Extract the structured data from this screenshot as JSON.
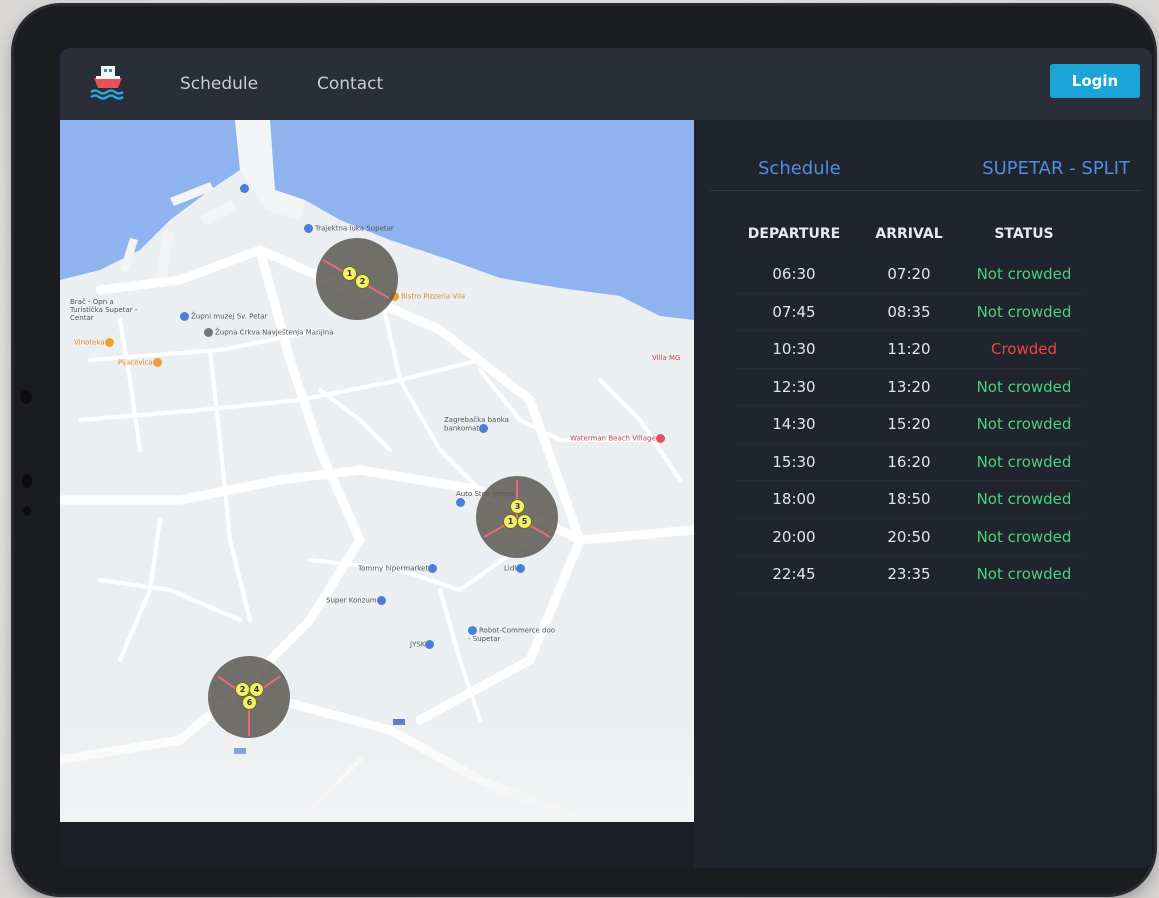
{
  "navbar": {
    "logo": "ship-logo-icon",
    "links": [
      "Schedule",
      "Contact"
    ],
    "login_label": "Login"
  },
  "map": {
    "pois": [
      {
        "label": "Trajektna luka Supetar",
        "kind": "blue"
      },
      {
        "label": "Bistro Pizzeria Vila",
        "kind": "orange"
      },
      {
        "label": "Župni muzej Sv. Petar",
        "kind": "blue"
      },
      {
        "label": "Župna Crkva Navještenja Marijina",
        "kind": "gray"
      },
      {
        "label": "Vinoteka",
        "kind": "orange"
      },
      {
        "label": "Pijacevica",
        "kind": "orange"
      },
      {
        "label": "Brač - Opn a Turistička Supetar - Centar",
        "kind": "blue"
      },
      {
        "label": "Zagrebačka banka bankomat",
        "kind": "blue"
      },
      {
        "label": "Waterman Beach Village",
        "kind": "red"
      },
      {
        "label": "Villa MG",
        "kind": "red"
      },
      {
        "label": "Auto Stop Jelena",
        "kind": "blue"
      },
      {
        "label": "Tommy hipermarket",
        "kind": "blue"
      },
      {
        "label": "Lidl",
        "kind": "blue"
      },
      {
        "label": "Super Konzum",
        "kind": "blue"
      },
      {
        "label": "JYSK",
        "kind": "blue"
      },
      {
        "label": "Robot-Commerce doo - Supetar",
        "kind": "blue"
      }
    ],
    "clusters": [
      {
        "markers": [
          "1",
          "2"
        ]
      },
      {
        "markers": [
          "3",
          "1",
          "5"
        ]
      },
      {
        "markers": [
          "2",
          "4",
          "6"
        ]
      }
    ]
  },
  "panel": {
    "tab_schedule": "Schedule",
    "route": "SUPETAR - SPLIT",
    "headers": [
      "DEPARTURE",
      "ARRIVAL",
      "STATUS"
    ],
    "rows": [
      {
        "departure": "06:30",
        "arrival": "07:20",
        "status": "Not crowded",
        "crowded": false
      },
      {
        "departure": "07:45",
        "arrival": "08:35",
        "status": "Not crowded",
        "crowded": false
      },
      {
        "departure": "10:30",
        "arrival": "11:20",
        "status": "Crowded",
        "crowded": true
      },
      {
        "departure": "12:30",
        "arrival": "13:20",
        "status": "Not crowded",
        "crowded": false
      },
      {
        "departure": "14:30",
        "arrival": "15:20",
        "status": "Not crowded",
        "crowded": false
      },
      {
        "departure": "15:30",
        "arrival": "16:20",
        "status": "Not crowded",
        "crowded": false
      },
      {
        "departure": "18:00",
        "arrival": "18:50",
        "status": "Not crowded",
        "crowded": false
      },
      {
        "departure": "20:00",
        "arrival": "20:50",
        "status": "Not crowded",
        "crowded": false
      },
      {
        "departure": "22:45",
        "arrival": "23:35",
        "status": "Not crowded",
        "crowded": false
      }
    ],
    "colors": {
      "not_crowded": "#4cd17a",
      "crowded": "#f2433d",
      "accent": "#4f8fe0"
    }
  }
}
